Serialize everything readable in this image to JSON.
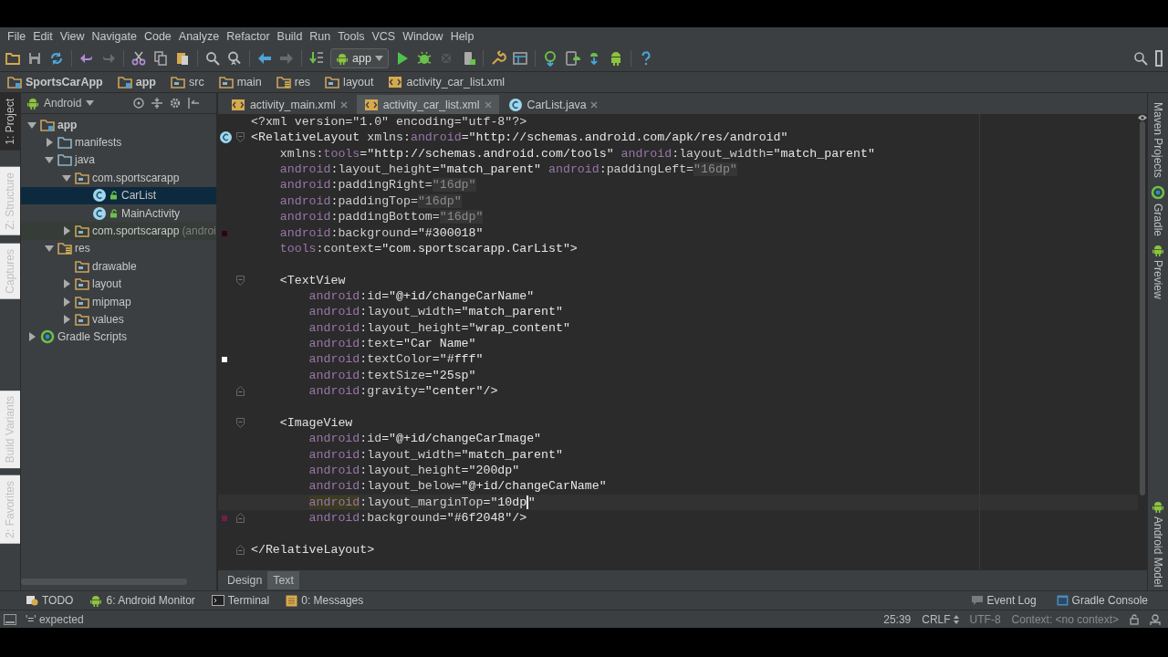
{
  "menu": [
    "File",
    "Edit",
    "View",
    "Navigate",
    "Code",
    "Analyze",
    "Refactor",
    "Build",
    "Run",
    "Tools",
    "VCS",
    "Window",
    "Help"
  ],
  "toolbar": {
    "run_config": "app"
  },
  "breadcrumbs": [
    {
      "label": "SportsCarApp",
      "kind": "module"
    },
    {
      "label": "app",
      "kind": "module"
    },
    {
      "label": "src",
      "kind": "folder"
    },
    {
      "label": "main",
      "kind": "folder"
    },
    {
      "label": "res",
      "kind": "res"
    },
    {
      "label": "layout",
      "kind": "package"
    },
    {
      "label": "activity_car_list.xml",
      "kind": "xml"
    }
  ],
  "left_tool_tabs": [
    {
      "label": "1: Project",
      "selected": true
    },
    {
      "label": "Z: Structure",
      "selected": false
    },
    {
      "label": "Captures",
      "selected": false
    },
    {
      "label": "Build Variants",
      "selected": false
    },
    {
      "label": "2: Favorites",
      "selected": false
    }
  ],
  "project_panel": {
    "view": "Android",
    "tree": [
      {
        "label": "app",
        "kind": "module",
        "expanded": true,
        "selected": false,
        "children": [
          {
            "label": "manifests",
            "kind": "folder",
            "expanded": false,
            "selected": false
          },
          {
            "label": "java",
            "kind": "folder",
            "expanded": true,
            "selected": false,
            "children": [
              {
                "label": "com.sportscarapp",
                "kind": "package",
                "expanded": true,
                "selected": false,
                "children": [
                  {
                    "label": "CarList",
                    "kind": "class",
                    "selected": true
                  },
                  {
                    "label": "MainActivity",
                    "kind": "class",
                    "selected": false
                  }
                ]
              },
              {
                "label": "com.sportscarapp",
                "note": "(androi",
                "kind": "test-package",
                "expanded": false,
                "selected": false
              }
            ]
          },
          {
            "label": "res",
            "kind": "res",
            "expanded": true,
            "selected": false,
            "children": [
              {
                "label": "drawable",
                "kind": "package",
                "selected": false
              },
              {
                "label": "layout",
                "kind": "package",
                "expanded": false,
                "selected": false
              },
              {
                "label": "mipmap",
                "kind": "package",
                "expanded": false,
                "selected": false
              },
              {
                "label": "values",
                "kind": "package",
                "expanded": false,
                "selected": false
              }
            ]
          }
        ]
      },
      {
        "label": "Gradle Scripts",
        "kind": "gradle",
        "expanded": false,
        "selected": false
      }
    ]
  },
  "editor_tabs": [
    {
      "label": "activity_main.xml",
      "kind": "xml",
      "selected": false
    },
    {
      "label": "activity_car_list.xml",
      "kind": "xml",
      "selected": true
    },
    {
      "label": "CarList.java",
      "kind": "class",
      "selected": false
    }
  ],
  "code": [
    {
      "kind": "root",
      "segments": [
        {
          "kind": "plain",
          "text": "<?xml version=\"1.0\" encoding=\"utf-8\"?>"
        }
      ]
    },
    {
      "kind": "root",
      "class_marker": true,
      "fold_start": true,
      "segments": [
        {
          "kind": "tag",
          "text": "<RelativeLayout "
        },
        {
          "kind": "attr",
          "text": "xmlns:"
        },
        {
          "kind": "ns",
          "text": "android"
        },
        {
          "kind": "value",
          "text": "=\"http://schemas.android.com/apk/res/android\""
        }
      ]
    },
    {
      "kind": "attr",
      "segments": [
        {
          "kind": "attr",
          "text": "xmlns:"
        },
        {
          "kind": "ns",
          "text": "tools"
        },
        {
          "kind": "value",
          "text": "=\"http://schemas.android.com/tools\" "
        },
        {
          "kind": "ns",
          "text": "android"
        },
        {
          "kind": "attr",
          "text": ":layout_width"
        },
        {
          "kind": "value",
          "text": "=\"match_parent\""
        }
      ]
    },
    {
      "kind": "attr",
      "segments": [
        {
          "kind": "ns",
          "text": "android"
        },
        {
          "kind": "attr",
          "text": ":layout_height"
        },
        {
          "kind": "value",
          "text": "=\"match_parent\" "
        },
        {
          "kind": "ns",
          "text": "android"
        },
        {
          "kind": "attr",
          "text": ":paddingLeft="
        },
        {
          "kind": "dim",
          "text": "\"16dp\""
        }
      ]
    },
    {
      "kind": "attr",
      "segments": [
        {
          "kind": "ns",
          "text": "android"
        },
        {
          "kind": "attr",
          "text": ":paddingRight="
        },
        {
          "kind": "dim",
          "text": "\"16dp\""
        }
      ]
    },
    {
      "kind": "attr",
      "segments": [
        {
          "kind": "ns",
          "text": "android"
        },
        {
          "kind": "attr",
          "text": ":paddingTop="
        },
        {
          "kind": "dim",
          "text": "\"16dp\""
        }
      ]
    },
    {
      "kind": "attr",
      "segments": [
        {
          "kind": "ns",
          "text": "android"
        },
        {
          "kind": "attr",
          "text": ":paddingBottom="
        },
        {
          "kind": "dim",
          "text": "\"16dp\""
        }
      ]
    },
    {
      "kind": "attr",
      "color": "#300018",
      "segments": [
        {
          "kind": "ns",
          "text": "android"
        },
        {
          "kind": "attr",
          "text": ":background"
        },
        {
          "kind": "value",
          "text": "=\"#300018\""
        }
      ]
    },
    {
      "kind": "attr",
      "segments": [
        {
          "kind": "ns",
          "text": "tools"
        },
        {
          "kind": "attr",
          "text": ":context"
        },
        {
          "kind": "value",
          "text": "=\"com.sportscarapp.CarList\">"
        }
      ]
    },
    {
      "kind": "blank"
    },
    {
      "kind": "child",
      "fold_start": true,
      "segments": [
        {
          "kind": "tag",
          "text": "<TextView"
        }
      ]
    },
    {
      "kind": "child-attr",
      "segments": [
        {
          "kind": "ns",
          "text": "android"
        },
        {
          "kind": "attr",
          "text": ":id"
        },
        {
          "kind": "value",
          "text": "=\"@+id/changeCarName\""
        }
      ]
    },
    {
      "kind": "child-attr",
      "segments": [
        {
          "kind": "ns",
          "text": "android"
        },
        {
          "kind": "attr",
          "text": ":layout_width"
        },
        {
          "kind": "value",
          "text": "=\"match_parent\""
        }
      ]
    },
    {
      "kind": "child-attr",
      "segments": [
        {
          "kind": "ns",
          "text": "android"
        },
        {
          "kind": "attr",
          "text": ":layout_height"
        },
        {
          "kind": "value",
          "text": "=\"wrap_content\""
        }
      ]
    },
    {
      "kind": "child-attr",
      "segments": [
        {
          "kind": "ns",
          "text": "android"
        },
        {
          "kind": "attr",
          "text": ":text"
        },
        {
          "kind": "value",
          "text": "=\"Car Name\""
        }
      ]
    },
    {
      "kind": "child-attr",
      "color": "#ffffff",
      "segments": [
        {
          "kind": "ns",
          "text": "android"
        },
        {
          "kind": "attr",
          "text": ":textColor"
        },
        {
          "kind": "value",
          "text": "=\"#fff\""
        }
      ]
    },
    {
      "kind": "child-attr",
      "segments": [
        {
          "kind": "ns",
          "text": "android"
        },
        {
          "kind": "attr",
          "text": ":textSize"
        },
        {
          "kind": "value",
          "text": "=\"25sp\""
        }
      ]
    },
    {
      "kind": "child-attr",
      "fold_end": true,
      "segments": [
        {
          "kind": "ns",
          "text": "android"
        },
        {
          "kind": "attr",
          "text": ":gravity"
        },
        {
          "kind": "value",
          "text": "=\"center\"/>"
        }
      ]
    },
    {
      "kind": "blank"
    },
    {
      "kind": "child",
      "fold_start": true,
      "segments": [
        {
          "kind": "tag",
          "text": "<ImageView"
        }
      ]
    },
    {
      "kind": "child-attr",
      "segments": [
        {
          "kind": "ns",
          "text": "android"
        },
        {
          "kind": "attr",
          "text": ":id"
        },
        {
          "kind": "value",
          "text": "=\"@+id/changeCarImage\""
        }
      ]
    },
    {
      "kind": "child-attr",
      "segments": [
        {
          "kind": "ns",
          "text": "android"
        },
        {
          "kind": "attr",
          "text": ":layout_width"
        },
        {
          "kind": "value",
          "text": "=\"match_parent\""
        }
      ]
    },
    {
      "kind": "child-attr",
      "segments": [
        {
          "kind": "ns",
          "text": "android"
        },
        {
          "kind": "attr",
          "text": ":layout_height"
        },
        {
          "kind": "value",
          "text": "=\"200dp\""
        }
      ]
    },
    {
      "kind": "child-attr",
      "segments": [
        {
          "kind": "ns",
          "text": "android"
        },
        {
          "kind": "attr",
          "text": ":layout_below"
        },
        {
          "kind": "value",
          "text": "=\"@+id/changeCarName\""
        }
      ]
    },
    {
      "kind": "child-attr",
      "current": true,
      "segments": [
        {
          "kind": "ns-hl",
          "text": "android"
        },
        {
          "kind": "attr",
          "text": ":layout_marginTop"
        },
        {
          "kind": "value",
          "text": "=\"10dp\""
        }
      ]
    },
    {
      "kind": "child-attr",
      "color": "#6f2048",
      "fold_end": true,
      "segments": [
        {
          "kind": "ns",
          "text": "android"
        },
        {
          "kind": "attr",
          "text": ":background"
        },
        {
          "kind": "value",
          "text": "=\"#6f2048\"/>"
        }
      ]
    },
    {
      "kind": "blank"
    },
    {
      "kind": "root",
      "fold_end": true,
      "segments": [
        {
          "kind": "tag",
          "text": "</RelativeLayout>"
        }
      ]
    }
  ],
  "editor_mode_tabs": [
    {
      "label": "Design",
      "selected": false
    },
    {
      "label": "Text",
      "selected": true
    }
  ],
  "right_tool_tabs": [
    {
      "label": "Maven Projects",
      "kind": "maven"
    },
    {
      "label": "Gradle",
      "kind": "gradle"
    },
    {
      "label": "Preview",
      "kind": "android"
    },
    {
      "label": "Android Model",
      "kind": "android"
    }
  ],
  "bottom_tools": {
    "left": [
      {
        "label": "TODO",
        "kind": "todo"
      },
      {
        "label": "6: Android Monitor",
        "kind": "android"
      },
      {
        "label": "Terminal",
        "kind": "terminal"
      },
      {
        "label": "0: Messages",
        "kind": "messages"
      }
    ],
    "right": [
      {
        "label": "Event Log",
        "kind": "log"
      },
      {
        "label": "Gradle Console",
        "kind": "console"
      }
    ]
  },
  "status_bar": {
    "message": "'=' expected",
    "position": "25:39",
    "line_separator": "CRLF",
    "encoding": "UTF-8",
    "context": "Context: <no context>"
  }
}
